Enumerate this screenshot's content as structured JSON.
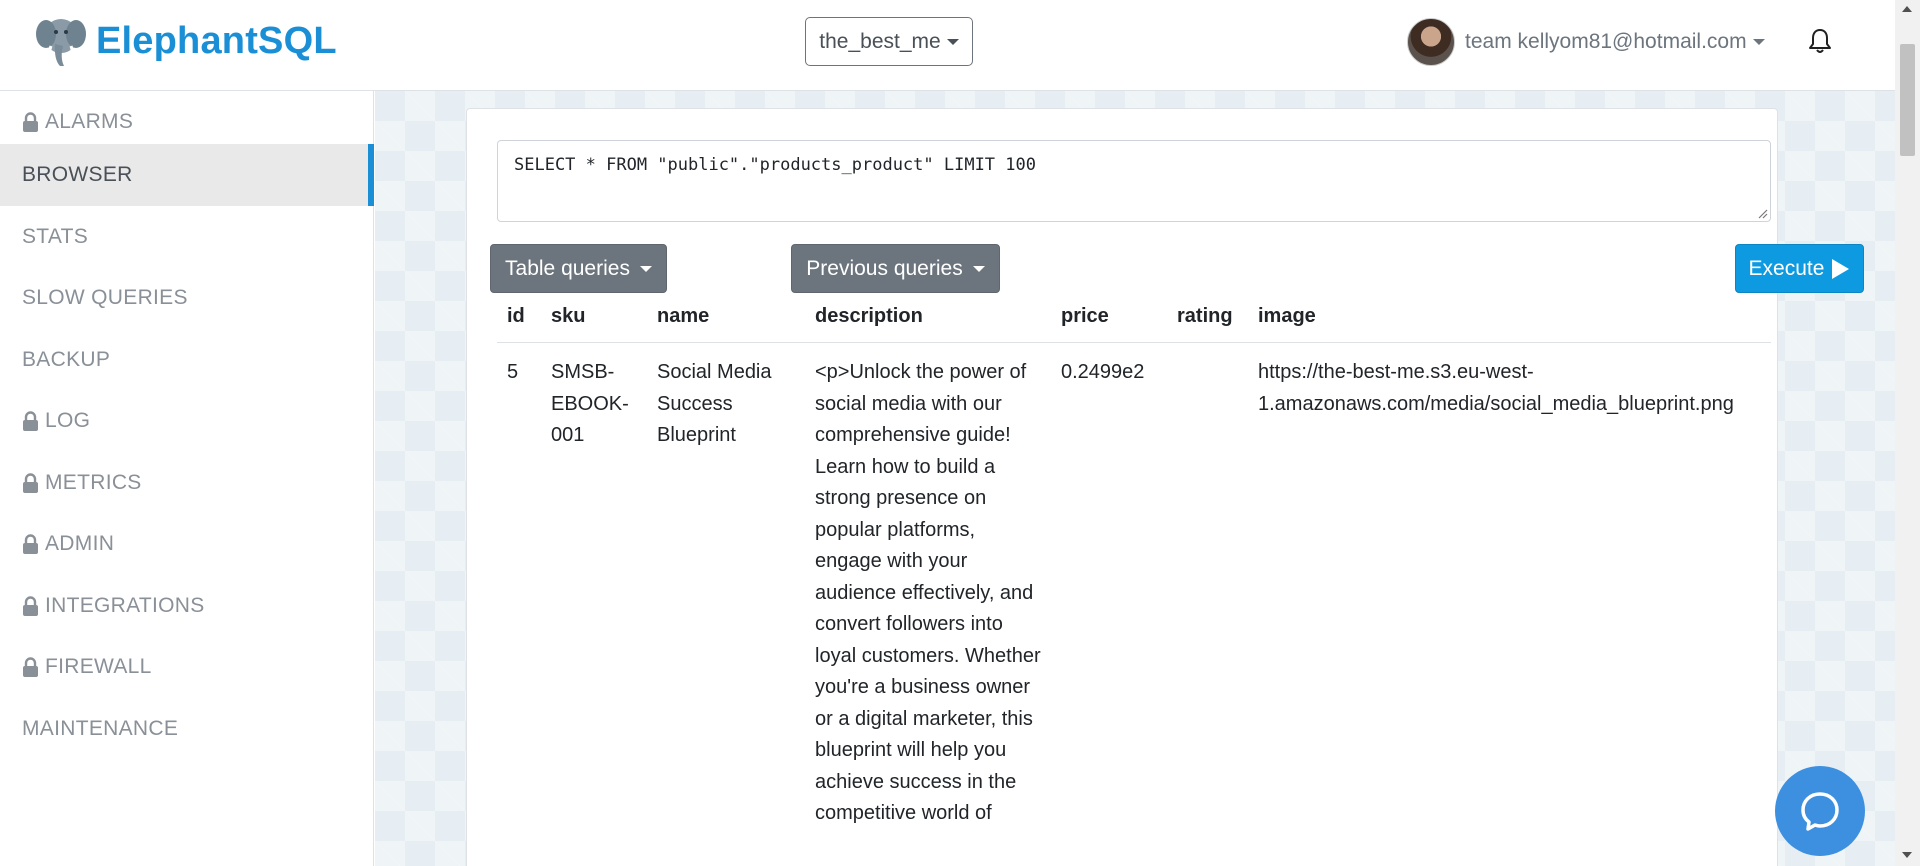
{
  "header": {
    "brand": "ElephantSQL",
    "instance": "the_best_me",
    "user": "team kellyom81@hotmail.com"
  },
  "sidebar": {
    "items": [
      {
        "label": "ALARMS",
        "locked": true
      },
      {
        "label": "BROWSER",
        "locked": false,
        "active": true
      },
      {
        "label": "STATS",
        "locked": false
      },
      {
        "label": "SLOW QUERIES",
        "locked": false
      },
      {
        "label": "BACKUP",
        "locked": false
      },
      {
        "label": "LOG",
        "locked": true
      },
      {
        "label": "METRICS",
        "locked": true
      },
      {
        "label": "ADMIN",
        "locked": true
      },
      {
        "label": "INTEGRATIONS",
        "locked": true
      },
      {
        "label": "FIREWALL",
        "locked": true
      },
      {
        "label": "MAINTENANCE",
        "locked": false
      }
    ]
  },
  "query": {
    "text": "SELECT * FROM \"public\".\"products_product\" LIMIT 100"
  },
  "buttons": {
    "table_queries": "Table queries",
    "previous_queries": "Previous queries",
    "execute": "Execute"
  },
  "results": {
    "columns": [
      "id",
      "sku",
      "name",
      "description",
      "price",
      "rating",
      "image"
    ],
    "rows": [
      {
        "id": "5",
        "sku": "SMSB-EBOOK-001",
        "name": "Social Media Success Blueprint",
        "description": "<p>Unlock the power of social media with our comprehensive guide! Learn how to build a strong presence on popular platforms, engage with your audience effectively, and convert followers into loyal customers. Whether you're a business owner or a digital marketer, this blueprint will help you achieve success in the competitive world of",
        "price": "0.2499e2",
        "rating": "",
        "image": "https://the-best-me.s3.eu-west-1.amazonaws.com/media/social_media_blueprint.png"
      }
    ]
  },
  "icons": {
    "logo": "elephant-icon",
    "lock": "lock-icon",
    "bell": "bell-icon",
    "chat": "chat-icon",
    "execute": "play-icon"
  },
  "colors": {
    "brand": "#1a8fd6",
    "execute": "#0d9ae0",
    "secondary_button": "#6c757d",
    "chat": "#3d8fe0"
  }
}
